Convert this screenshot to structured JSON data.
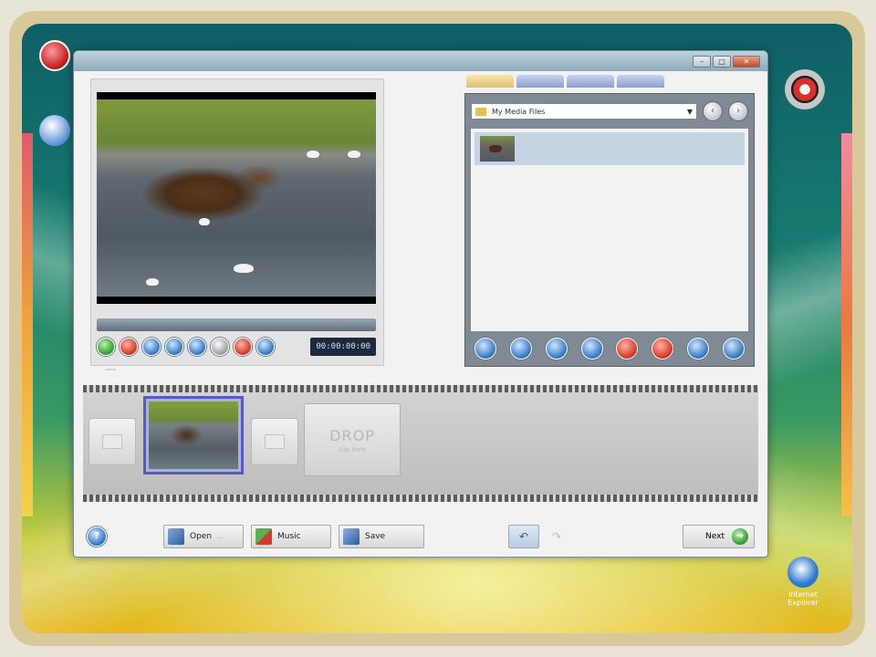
{
  "window": {
    "title": "",
    "min_label": "–",
    "max_label": "□",
    "close_label": "✕"
  },
  "desktop": {
    "icons": [
      {
        "name": "recycle-bin-icon",
        "label": ""
      },
      {
        "name": "user-folder-icon",
        "label": ""
      },
      {
        "name": "disc-icon",
        "label": ""
      },
      {
        "name": "internet-explorer-icon",
        "label": "Internet Explorer"
      }
    ]
  },
  "preview": {
    "timecode": "00:00:00:00",
    "controls": [
      {
        "name": "play-button-icon",
        "color": "green"
      },
      {
        "name": "stop-button-icon",
        "color": "red"
      },
      {
        "name": "prev-frame-icon",
        "color": "blue"
      },
      {
        "name": "snapshot-icon",
        "color": "blue"
      },
      {
        "name": "next-frame-icon",
        "color": "blue"
      },
      {
        "name": "volume-icon",
        "color": "gray"
      },
      {
        "name": "record-icon",
        "color": "red"
      },
      {
        "name": "settings-icon",
        "color": "blue"
      }
    ],
    "tabs": [
      "",
      ""
    ]
  },
  "library": {
    "tabs": [
      "",
      "",
      "",
      ""
    ],
    "folder": "My Media Files",
    "items": [
      {
        "name": ""
      }
    ],
    "toolbar": [
      {
        "name": "import-icon",
        "color": "blue"
      },
      {
        "name": "capture-icon",
        "color": "blue"
      },
      {
        "name": "film-icon",
        "color": "blue"
      },
      {
        "name": "effect-icon",
        "color": "blue"
      },
      {
        "name": "delete-icon",
        "color": "red"
      },
      {
        "name": "remove-icon",
        "color": "red"
      },
      {
        "name": "sort-icon",
        "color": "blue"
      },
      {
        "name": "add-icon",
        "color": "blue"
      }
    ]
  },
  "storyboard": {
    "empty_slot_main": "DROP",
    "empty_slot_sub": "clip here"
  },
  "bottom": {
    "help_label": "?",
    "open_label": "Open",
    "open_sub": "...",
    "music_label": "Music",
    "save_label": "Save",
    "undo_label": "↶",
    "redo_label": "↷",
    "next_label": "Next",
    "next_icon": "➔"
  },
  "colors": {
    "accent_blue": "#2e74c4",
    "accent_green": "#2f9a2b",
    "accent_red": "#d6321c",
    "frame": "#d9c99a"
  }
}
